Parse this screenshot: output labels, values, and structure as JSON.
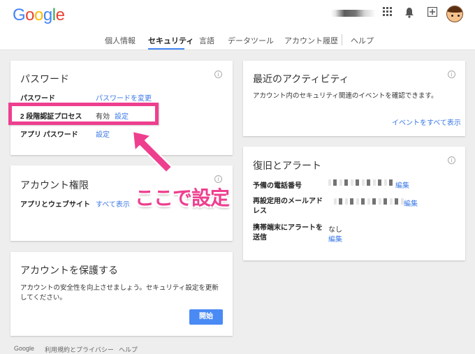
{
  "logo": {
    "letters": [
      "G",
      "o",
      "o",
      "g",
      "l",
      "e"
    ],
    "colors": [
      "#4285f4",
      "#ea4335",
      "#fbbc05",
      "#4285f4",
      "#34a853",
      "#ea4335"
    ]
  },
  "nav": {
    "items": [
      "個人情報",
      "セキュリティ",
      "言語",
      "データツール",
      "アカウント履歴",
      "ヘルプ"
    ],
    "active_color": "#4285f4"
  },
  "password_card": {
    "title": "パスワード",
    "rows": [
      {
        "label": "パスワード",
        "link": "パスワードを変更"
      },
      {
        "label": "2 段階認証プロセス",
        "value": "有効",
        "link": "設定"
      },
      {
        "label": "アプリ パスワード",
        "link": "設定"
      }
    ]
  },
  "permissions_card": {
    "title": "アカウント権限",
    "label": "アプリとウェブサイト",
    "link": "すべて表示"
  },
  "protect_card": {
    "title": "アカウントを保護する",
    "description": "アカウントの安全性を向上させましょう。セキュリティ設定を更新してください。",
    "button": "開始"
  },
  "activity_card": {
    "title": "最近のアクティビティ",
    "description": "アカウント内のセキュリティ関連のイベントを確認できます。",
    "link": "イベントをすべて表示"
  },
  "recovery_card": {
    "title": "復旧とアラート",
    "rows": [
      {
        "label": "予備の電話番号",
        "link": "編集"
      },
      {
        "label": "再設定用のメールアドレス",
        "link": "編集"
      },
      {
        "label": "携帯端末にアラートを送信",
        "value": "なし",
        "link": "編集"
      }
    ]
  },
  "annotation": {
    "text": "ここで設定",
    "color": "#ee3f8f"
  },
  "footer": [
    "Google",
    "利用規約とプライバシー",
    "ヘルプ"
  ],
  "icons": [
    "apps-icon",
    "bell-icon",
    "add-box-icon",
    "info-icon"
  ]
}
